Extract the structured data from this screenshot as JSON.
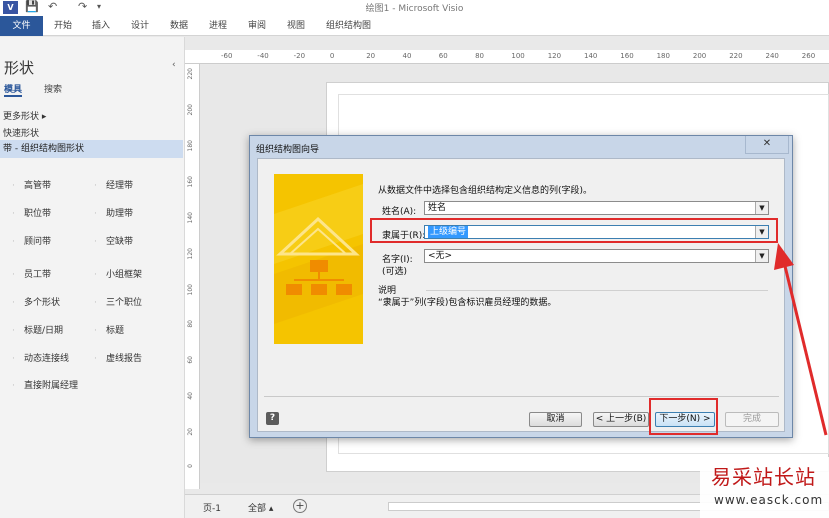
{
  "titlebar": {
    "app_icon": "V",
    "qat": [
      "💾",
      "↶",
      "↷",
      "▾"
    ],
    "window_title": "绘图1 - Microsoft Visio"
  },
  "ribbon": {
    "tabs": [
      "文件",
      "开始",
      "插入",
      "设计",
      "数据",
      "进程",
      "审阅",
      "视图",
      "组织结构图"
    ]
  },
  "shapes_panel": {
    "title": "形状",
    "collapse": "‹",
    "tabs": {
      "stencils": "模具",
      "search": "搜索"
    },
    "more_shapes": "更多形状",
    "quick_shapes": "快速形状",
    "selected_stencil": "带 - 组织结构图形状",
    "shapes": [
      [
        "高管带",
        "经理带"
      ],
      [
        "职位带",
        "助理带"
      ],
      [
        "顾问带",
        "空缺带"
      ],
      [
        "员工带",
        "小组框架"
      ],
      [
        "多个形状",
        "三个职位"
      ],
      [
        "标题/日期",
        "标题"
      ],
      [
        "动态连接线",
        "虚线报告"
      ],
      [
        "直接附属经理",
        ""
      ]
    ]
  },
  "ruler": {
    "top_labels": [
      "-60",
      "-40",
      "-20",
      "0",
      "20",
      "40",
      "60",
      "80",
      "100",
      "120",
      "140",
      "160",
      "180",
      "200",
      "220",
      "240",
      "260"
    ],
    "left_labels": [
      "220",
      "200",
      "180",
      "160",
      "140",
      "120",
      "100",
      "80",
      "60",
      "40",
      "20",
      "0"
    ]
  },
  "status": {
    "page_tab": "页-1",
    "all_tab": "全部 ▴",
    "add_page": "+"
  },
  "dialog": {
    "title": "组织结构图向导",
    "close": "✕",
    "intro": "从数据文件中选择包含组织结构定义信息的列(字段)。",
    "name_label": "姓名(A):",
    "name_value": "姓名",
    "reports_to_label": "隶属于(R):",
    "reports_to_value": "上级编号",
    "first_name_label_1": "名字(I):",
    "first_name_label_2": "(可选)",
    "first_name_value": "<无>",
    "desc_title": "说明",
    "desc_text": "“隶属于”列(字段)包含标识雇员经理的数据。",
    "help": "?",
    "cancel": "取消",
    "back": "< 上一步(B)",
    "next": "下一步(N) >",
    "finish": "完成",
    "combo_arrow": "▼"
  },
  "watermark": {
    "main": "易采站长站",
    "url": "www.easck.com"
  },
  "colors": {
    "file_tab": "#2b579a",
    "highlight": "#e02b2b",
    "illustration": "#f5c400"
  }
}
